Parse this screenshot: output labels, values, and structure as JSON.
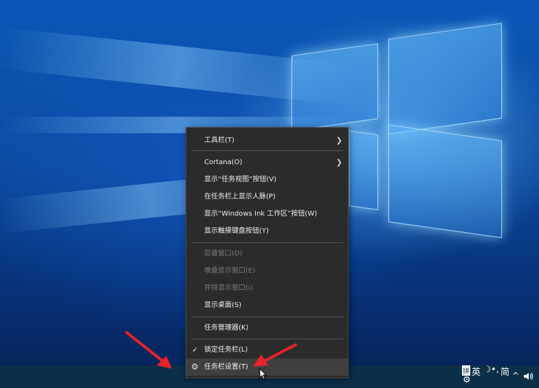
{
  "context_menu": {
    "items": [
      {
        "label": "工具栏(T)",
        "submenu": true,
        "enabled": true
      },
      {
        "label": "Cortana(O)",
        "submenu": true,
        "enabled": true
      },
      {
        "label": "显示“任务视图”按钮(V)",
        "enabled": true
      },
      {
        "label": "在任务栏上显示人脉(P)",
        "enabled": true
      },
      {
        "label": "显示“Windows Ink 工作区”按钮(W)",
        "enabled": true
      },
      {
        "label": "显示触摸键盘按钮(Y)",
        "enabled": true
      },
      {
        "label": "层叠窗口(D)",
        "enabled": false
      },
      {
        "label": "堆叠显示窗口(E)",
        "enabled": false
      },
      {
        "label": "并排显示窗口(I)",
        "enabled": false
      },
      {
        "label": "显示桌面(S)",
        "enabled": true
      },
      {
        "label": "任务管理器(K)",
        "enabled": true
      },
      {
        "label": "锁定任务栏(L)",
        "checked": true,
        "enabled": true
      },
      {
        "label": "任务栏设置(T)",
        "icon": "gear-icon",
        "enabled": true,
        "hover": true
      }
    ]
  },
  "tray": {
    "ime_mode": "英",
    "ime_moon": "☽",
    "ime_punct": "•,",
    "ime_script": "简",
    "ime_icon": "拼",
    "chevron": "^"
  },
  "colors": {
    "menu_bg": "#2b2b2b",
    "taskbar_bg": "#0b2f48",
    "annotation_arrow": "#e8232a"
  }
}
